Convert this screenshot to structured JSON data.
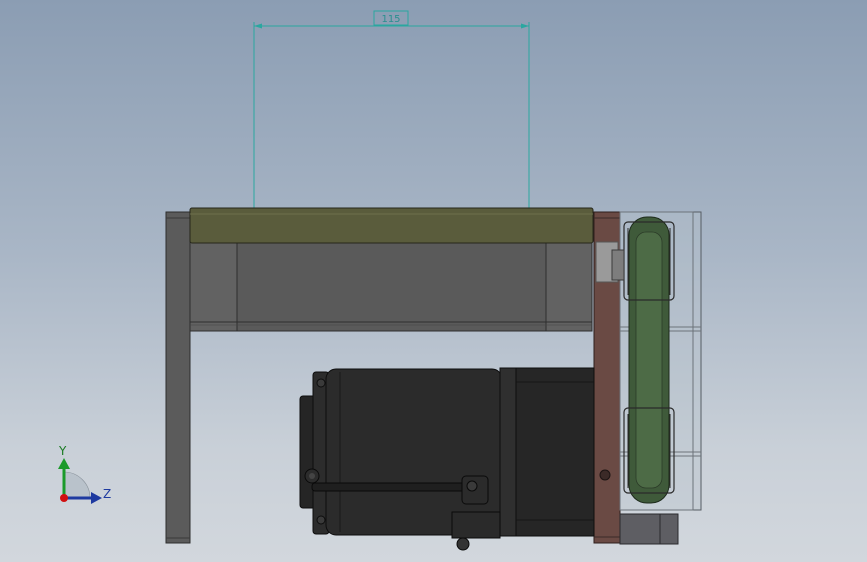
{
  "dimension": {
    "value": "115"
  },
  "triad": {
    "y_label": "Y",
    "z_label": "Z"
  },
  "colors": {
    "dimension_line": "#2aa7a0",
    "top_plate": "#5a5c3c",
    "frame_dark": "#5b5b5b",
    "motor_body": "#2b2b2b",
    "side_plate": "#6a4a44",
    "belt": "#3f5a3a",
    "axis_y": "#1a9a2a",
    "axis_z": "#1e3aa0",
    "axis_origin": "#d01010"
  }
}
